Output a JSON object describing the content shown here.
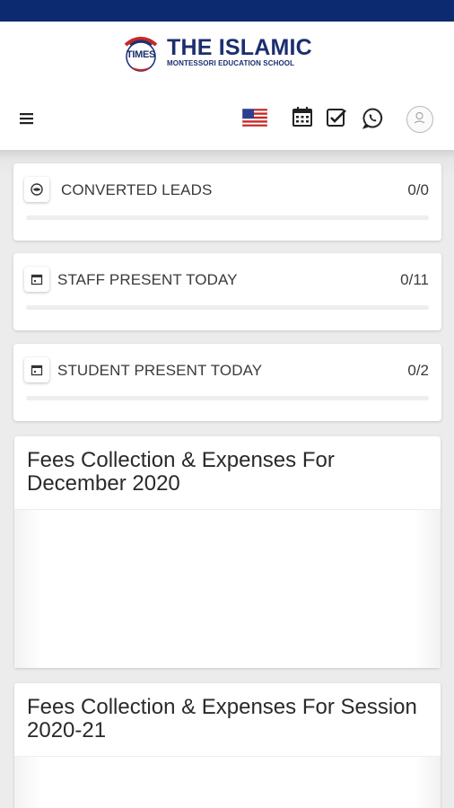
{
  "header": {
    "logo_badge_text": "TIMES",
    "logo_title": "THE ISLAMIC",
    "logo_subtitle": "MONTESSORI EDUCATION SCHOOL"
  },
  "toolbar": {
    "icons": [
      "menu-icon",
      "us-flag-icon",
      "calendar-icon",
      "checkbox-icon",
      "whatsapp-icon",
      "avatar"
    ]
  },
  "stats": [
    {
      "label": "CONVERTED LEADS",
      "value": "0/0",
      "icon": "eye-icon",
      "progress": 0
    },
    {
      "label": "STAFF PRESENT TODAY",
      "value": "0/11",
      "icon": "calendar-icon",
      "progress": 0
    },
    {
      "label": "STUDENT PRESENT TODAY",
      "value": "0/2",
      "icon": "calendar-icon",
      "progress": 0
    }
  ],
  "fees": [
    {
      "title": "Fees Collection & Expenses For December 2020"
    },
    {
      "title": "Fees Collection & Expenses For Session 2020-21"
    }
  ],
  "colors": {
    "status_bar": "#0b2a6f",
    "brand": "#1b2f6e",
    "logo_red": "#c62828",
    "whatsapp": "#222222"
  }
}
